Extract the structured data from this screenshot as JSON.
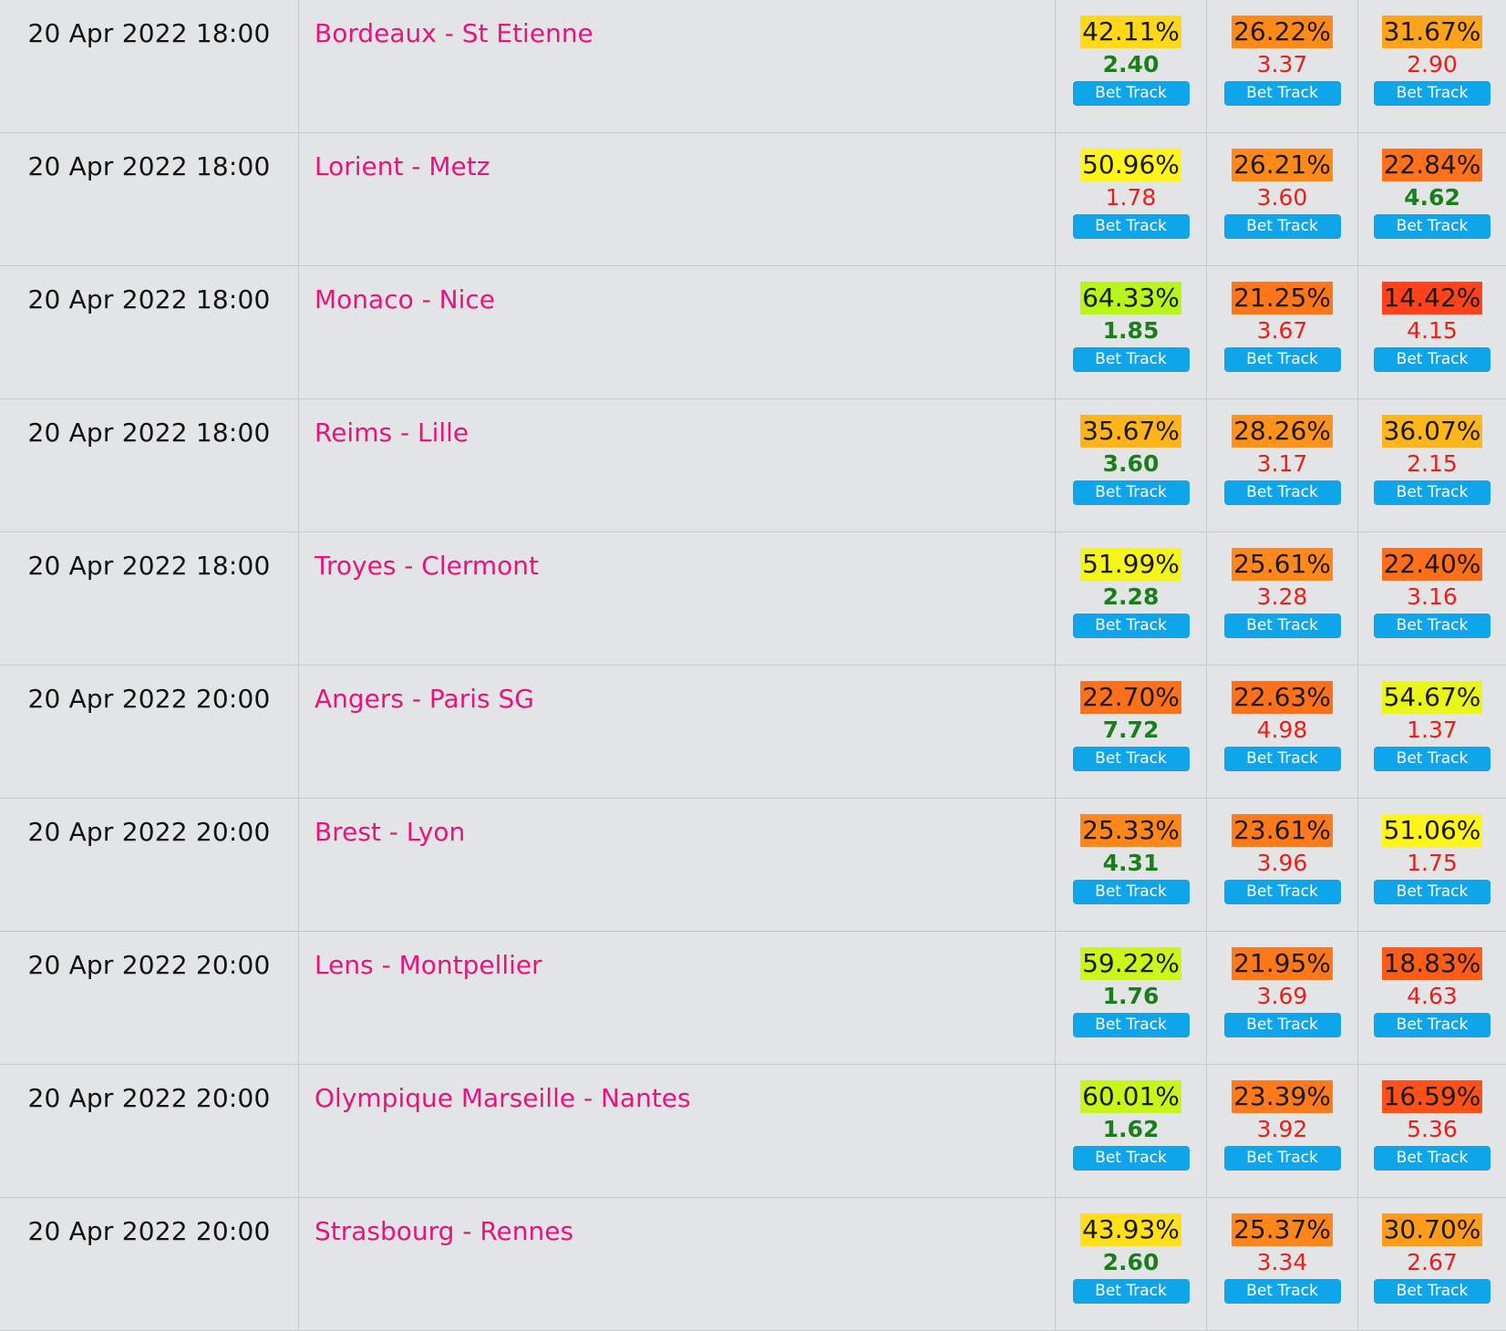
{
  "bet_button_label": "Bet Track",
  "matches": [
    {
      "date": "20 Apr 2022 18:00",
      "match": "Bordeaux - St Etienne",
      "outcomes": [
        {
          "pct": "42.11%",
          "odds": "2.40",
          "best": true,
          "color": "#ffd81a"
        },
        {
          "pct": "26.22%",
          "odds": "3.37",
          "best": false,
          "color": "#ff8a1a"
        },
        {
          "pct": "31.67%",
          "odds": "2.90",
          "best": false,
          "color": "#ffa31a"
        }
      ]
    },
    {
      "date": "20 Apr 2022 18:00",
      "match": "Lorient - Metz",
      "outcomes": [
        {
          "pct": "50.96%",
          "odds": "1.78",
          "best": false,
          "color": "#fff51a"
        },
        {
          "pct": "26.21%",
          "odds": "3.60",
          "best": false,
          "color": "#ff8a1a"
        },
        {
          "pct": "22.84%",
          "odds": "4.62",
          "best": true,
          "color": "#ff711a"
        }
      ]
    },
    {
      "date": "20 Apr 2022 18:00",
      "match": "Monaco - Nice",
      "outcomes": [
        {
          "pct": "64.33%",
          "odds": "1.85",
          "best": true,
          "color": "#b8f51a"
        },
        {
          "pct": "21.25%",
          "odds": "3.67",
          "best": false,
          "color": "#ff761a"
        },
        {
          "pct": "14.42%",
          "odds": "4.15",
          "best": false,
          "color": "#ff421a"
        }
      ]
    },
    {
      "date": "20 Apr 2022 18:00",
      "match": "Reims - Lille",
      "outcomes": [
        {
          "pct": "35.67%",
          "odds": "3.60",
          "best": true,
          "color": "#ffb41a"
        },
        {
          "pct": "28.26%",
          "odds": "3.17",
          "best": false,
          "color": "#ff921a"
        },
        {
          "pct": "36.07%",
          "odds": "2.15",
          "best": false,
          "color": "#ffb61a"
        }
      ]
    },
    {
      "date": "20 Apr 2022 18:00",
      "match": "Troyes - Clermont",
      "outcomes": [
        {
          "pct": "51.99%",
          "odds": "2.28",
          "best": true,
          "color": "#f5f51a"
        },
        {
          "pct": "25.61%",
          "odds": "3.28",
          "best": false,
          "color": "#ff881a"
        },
        {
          "pct": "22.40%",
          "odds": "3.16",
          "best": false,
          "color": "#ff6e1a"
        }
      ]
    },
    {
      "date": "20 Apr 2022 20:00",
      "match": "Angers - Paris SG",
      "outcomes": [
        {
          "pct": "22.70%",
          "odds": "7.72",
          "best": true,
          "color": "#ff701a"
        },
        {
          "pct": "22.63%",
          "odds": "4.98",
          "best": false,
          "color": "#ff701a"
        },
        {
          "pct": "54.67%",
          "odds": "1.37",
          "best": false,
          "color": "#eaf51a"
        }
      ]
    },
    {
      "date": "20 Apr 2022 20:00",
      "match": "Brest - Lyon",
      "outcomes": [
        {
          "pct": "25.33%",
          "odds": "4.31",
          "best": true,
          "color": "#ff861a"
        },
        {
          "pct": "23.61%",
          "odds": "3.96",
          "best": false,
          "color": "#ff7a1a"
        },
        {
          "pct": "51.06%",
          "odds": "1.75",
          "best": false,
          "color": "#fff51a"
        }
      ]
    },
    {
      "date": "20 Apr 2022 20:00",
      "match": "Lens - Montpellier",
      "outcomes": [
        {
          "pct": "59.22%",
          "odds": "1.76",
          "best": true,
          "color": "#ccf51a"
        },
        {
          "pct": "21.95%",
          "odds": "3.69",
          "best": false,
          "color": "#ff781a"
        },
        {
          "pct": "18.83%",
          "odds": "4.63",
          "best": false,
          "color": "#ff5c1a"
        }
      ]
    },
    {
      "date": "20 Apr 2022 20:00",
      "match": "Olympique Marseille - Nantes",
      "outcomes": [
        {
          "pct": "60.01%",
          "odds": "1.62",
          "best": true,
          "color": "#c8f51a"
        },
        {
          "pct": "23.39%",
          "odds": "3.92",
          "best": false,
          "color": "#ff7a1a"
        },
        {
          "pct": "16.59%",
          "odds": "5.36",
          "best": false,
          "color": "#ff501a"
        }
      ]
    },
    {
      "date": "20 Apr 2022 20:00",
      "match": "Strasbourg - Rennes",
      "outcomes": [
        {
          "pct": "43.93%",
          "odds": "2.60",
          "best": true,
          "color": "#ffde1a"
        },
        {
          "pct": "25.37%",
          "odds": "3.34",
          "best": false,
          "color": "#ff861a"
        },
        {
          "pct": "30.70%",
          "odds": "2.67",
          "best": false,
          "color": "#ff9d1a"
        }
      ]
    }
  ]
}
